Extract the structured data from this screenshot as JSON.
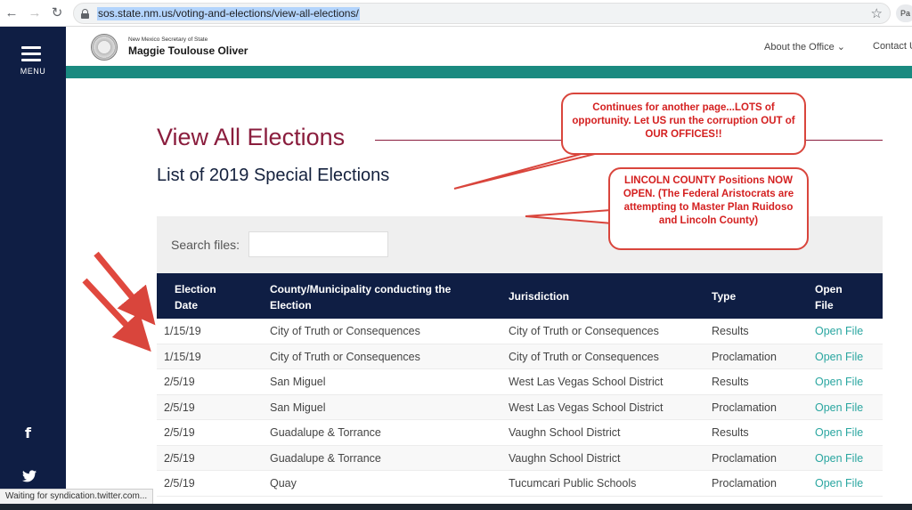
{
  "browser": {
    "url": "sos.state.nm.us/voting-and-elections/view-all-elections/",
    "profile_initial": "Pa",
    "status": "Waiting for syndication.twitter.com..."
  },
  "sidebar": {
    "menu_label": "MENU",
    "facebook": "f"
  },
  "header": {
    "office_small": "New Mexico Secretary of State",
    "office_name": "Maggie Toulouse Oliver",
    "nav_about": "About the Office ⌄",
    "nav_contact": "Contact U"
  },
  "main": {
    "title": "View All Elections",
    "subtitle": "List of 2019 Special Elections",
    "search_label": "Search files:"
  },
  "table": {
    "headers": [
      "Election Date",
      "County/Municipality conducting the Election",
      "Jurisdiction",
      "Type",
      "Open File"
    ],
    "rows": [
      [
        "1/15/19",
        "City of Truth or Consequences",
        "City of Truth or Consequences",
        "Results",
        "Open File"
      ],
      [
        "1/15/19",
        "City of Truth or Consequences",
        "City of Truth or Consequences",
        "Proclamation",
        "Open File"
      ],
      [
        "2/5/19",
        "San Miguel",
        "West Las Vegas School District",
        "Results",
        "Open File"
      ],
      [
        "2/5/19",
        "San Miguel",
        "West Las Vegas School District",
        "Proclamation",
        "Open File"
      ],
      [
        "2/5/19",
        "Guadalupe & Torrance",
        "Vaughn School District",
        "Results",
        "Open File"
      ],
      [
        "2/5/19",
        "Guadalupe & Torrance",
        "Vaughn School District",
        "Proclamation",
        "Open File"
      ],
      [
        "2/5/19",
        "Quay",
        "Tucumcari Public Schools",
        "Proclamation",
        "Open File"
      ]
    ]
  },
  "annotations": {
    "callout_1": "Continues for another page...LOTS of opportunity. Let US run the corruption OUT of OUR OFFICES!!",
    "callout_2": "LINCOLN COUNTY Positions NOW OPEN. (The Federal Aristocrats are attempting to Master Plan Ruidoso and Lincoln County)"
  },
  "colors": {
    "navy": "#0f1e44",
    "teal": "#1a8a80",
    "title": "#8a1d3d",
    "link": "#2aa6a0",
    "annotation": "#d9453c"
  }
}
